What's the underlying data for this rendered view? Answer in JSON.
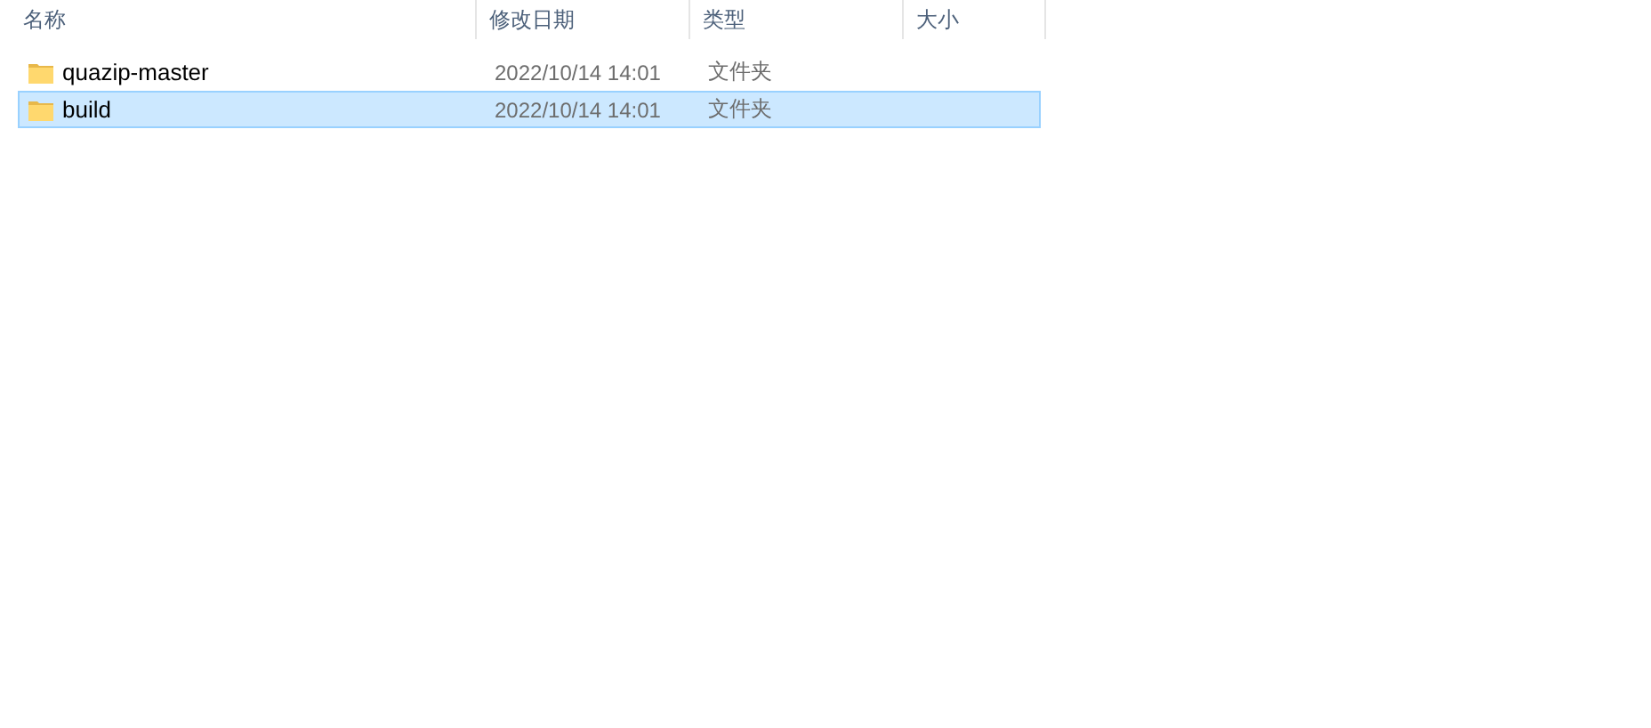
{
  "columns": [
    "名称",
    "修改日期",
    "类型",
    "大小"
  ],
  "rows": [
    {
      "name": "quazip-master",
      "modified": "2022/10/14 14:01",
      "type": "文件夹",
      "selected": false
    },
    {
      "name": "build",
      "modified": "2022/10/14 14:01",
      "type": "文件夹",
      "selected": true
    }
  ]
}
